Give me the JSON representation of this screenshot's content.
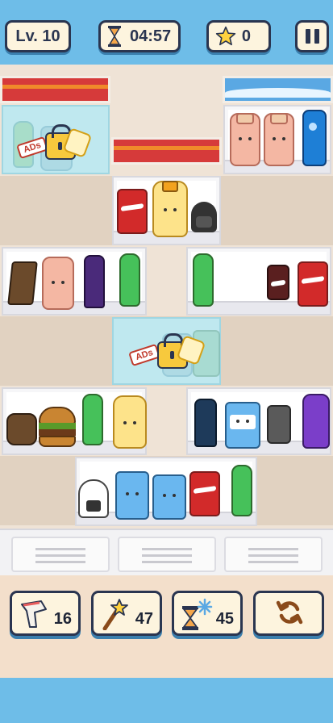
{
  "hud": {
    "level": "Lv. 10",
    "timer": "04:57",
    "stars": "0",
    "pause_icon": "pause-icon",
    "hourglass_icon": "hourglass-icon",
    "star_icon": "star-icon"
  },
  "locked_shelves": [
    {
      "badge": "ADs",
      "icon": "lock-icon"
    },
    {
      "badge": "ADs",
      "icon": "lock-icon"
    }
  ],
  "tools": [
    {
      "name": "scanner",
      "icon": "scanner-icon",
      "count": "16"
    },
    {
      "name": "magic-wand",
      "icon": "magic-wand-icon",
      "count": "47"
    },
    {
      "name": "freeze-time",
      "icon": "freeze-hourglass-icon",
      "count": "45"
    },
    {
      "name": "shuffle",
      "icon": "refresh-icon",
      "count": ""
    }
  ],
  "colors": {
    "sky": "#6ebde8",
    "panel": "#fdf4de",
    "outline": "#2a3550",
    "awning_red": "#d63a3a"
  }
}
